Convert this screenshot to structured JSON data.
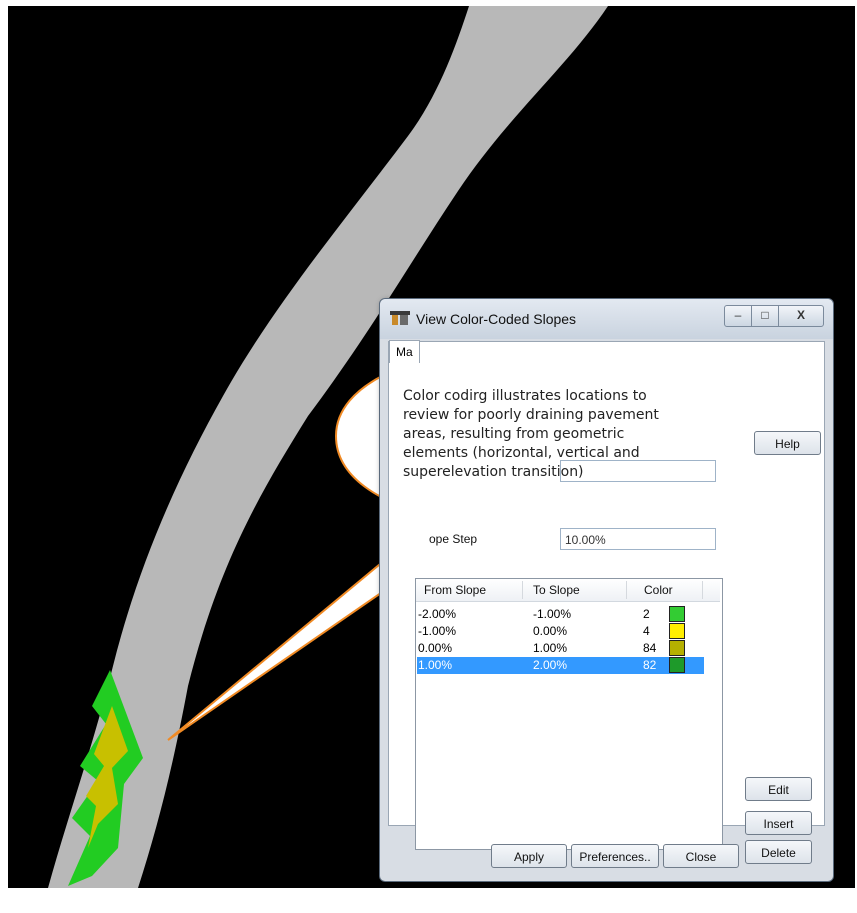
{
  "dialog": {
    "title": "View Color-Coded Slopes",
    "tab_main": "Ma",
    "window_buttons": {
      "minimize": "–",
      "maximize": "□",
      "close": "X"
    },
    "slope_step_label": "ope Step",
    "slope_step_value": "10.00%",
    "columns": [
      "From Slope",
      "To Slope",
      "Color"
    ],
    "rows": [
      {
        "from": "-2.00%",
        "to": "-1.00%",
        "color_index": "2",
        "swatch": "#33cc33",
        "selected": false
      },
      {
        "from": "-1.00%",
        "to": "0.00%",
        "color_index": "4",
        "swatch": "#ffee00",
        "selected": false
      },
      {
        "from": "0.00%",
        "to": "1.00%",
        "color_index": "84",
        "swatch": "#b5b000",
        "selected": false
      },
      {
        "from": "1.00%",
        "to": "2.00%",
        "color_index": "82",
        "swatch": "#1e9a2a",
        "selected": true
      }
    ],
    "buttons": {
      "help": "Help",
      "edit": "Edit",
      "insert": "Insert",
      "delete": "Delete",
      "apply": "Apply",
      "preferences": "Preferences..",
      "close": "Close"
    }
  },
  "callout": {
    "lines": [
      "Color codirg illustrates locations to",
      "review for poorly draining pavement",
      "areas, resulting from geometric",
      "elements (horizontal, vertical and",
      "superelevation transition)"
    ],
    "border_color": "#f08a24"
  },
  "road": {
    "surface_color": "#b8b8b8",
    "flag_colors": [
      "#22cc22",
      "#c8c000"
    ]
  }
}
